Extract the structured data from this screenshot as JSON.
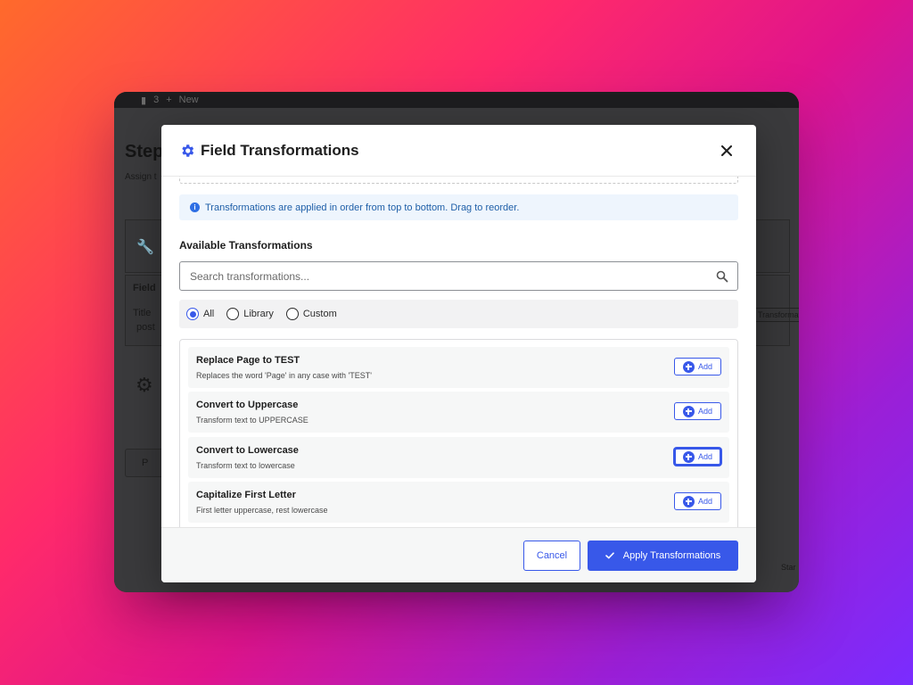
{
  "background_app": {
    "admin_bar": {
      "comments_count": "3",
      "new_label": "New"
    },
    "page_title": "Step",
    "page_subtitle": "Assign t",
    "field_header": "Field",
    "field_title": "Title",
    "field_value": "post",
    "transform_button": "Transformat",
    "prev_button": "P",
    "footer_text": "Star"
  },
  "modal": {
    "title": "Field Transformations",
    "info_text": "Transformations are applied in order from top to bottom. Drag to reorder.",
    "section_title": "Available Transformations",
    "search": {
      "placeholder": "Search transformations...",
      "value": ""
    },
    "filters": [
      {
        "label": "All",
        "checked": true
      },
      {
        "label": "Library",
        "checked": false
      },
      {
        "label": "Custom",
        "checked": false
      }
    ],
    "transformations": [
      {
        "name": "Replace Page to TEST",
        "description": "Replaces the word 'Page' in any case with 'TEST'",
        "add_label": "Add"
      },
      {
        "name": "Convert to Uppercase",
        "description": "Transform text to UPPERCASE",
        "add_label": "Add"
      },
      {
        "name": "Convert to Lowercase",
        "description": "Transform text to lowercase",
        "add_label": "Add"
      },
      {
        "name": "Capitalize First Letter",
        "description": "First letter uppercase, rest lowercase",
        "add_label": "Add"
      }
    ],
    "footer": {
      "cancel_label": "Cancel",
      "apply_label": "Apply Transformations"
    }
  },
  "colors": {
    "accent": "#3858e9",
    "info_bg": "#eef5fd",
    "info_text": "#1f5fa8"
  }
}
